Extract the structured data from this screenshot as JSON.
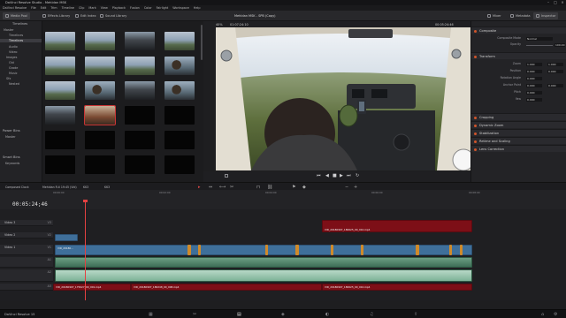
{
  "window": {
    "title": "DaVinci Resolve Studio - Mehldan MSK"
  },
  "menu": [
    "DaVinci Resolve",
    "File",
    "Edit",
    "Trim",
    "Timeline",
    "Clip",
    "Mark",
    "View",
    "Playback",
    "Fusion",
    "Color",
    "Fairlight",
    "Workspace",
    "Help"
  ],
  "toolbar": {
    "media_pool": "Media Pool",
    "effects_library": "Effects Library",
    "edit_index": "Edit Index",
    "sound_library": "Sound Library",
    "project_title": "Mehldan MSK - SPB (Copy)",
    "mixer": "Mixer",
    "metadata": "Metadata",
    "inspector": "Inspector"
  },
  "bins": {
    "header": "Timelines",
    "items": [
      "Master",
      "Timelines",
      "Audio",
      "Video",
      "Images",
      "Old",
      "Grade",
      "Music",
      "Sfx",
      "Nested"
    ],
    "power_bins": "Power Bins",
    "power_items": [
      "Master"
    ],
    "smart_bins": "Smart Bins",
    "smart_items": [
      "Keywords"
    ]
  },
  "viewer": {
    "zoom": "40%",
    "timecode": "01:07:24:10",
    "title": "Mehldan MSK - SPB (Copy)",
    "duration": "00:05:24:46"
  },
  "inspector": {
    "sections": [
      {
        "name": "Composite"
      },
      {
        "name": "Transform"
      },
      {
        "name": "Cropping"
      },
      {
        "name": "Dynamic Zoom"
      },
      {
        "name": "Stabilization"
      },
      {
        "name": "Retime and Scaling"
      },
      {
        "name": "Lens Correction"
      }
    ],
    "composite_mode_label": "Composite Mode",
    "composite_mode": "Normal",
    "opacity_label": "Opacity",
    "opacity": "100.00",
    "zoom_label": "Zoom",
    "zoom_x": "1.000",
    "zoom_y": "1.000",
    "position_label": "Position",
    "pos_x": "0.000",
    "pos_y": "0.000",
    "rotation_label": "Rotation Angle",
    "rotation": "0.000",
    "anchor_label": "Anchor Point",
    "anchor_x": "0.000",
    "anchor_y": "0.000",
    "pitch_label": "Pitch",
    "pitch": "0.000",
    "yaw_label": "Yaw",
    "yaw": "0.000"
  },
  "timeline": {
    "tabs": [
      "Composed Clock",
      "Mehldan R.ti 19:45 (Vid)",
      "KK3",
      "KK3"
    ],
    "timecode": "00:05:24;46",
    "ruler": [
      "00:00:00",
      "00:02:00",
      "00:04:00",
      "00:06:00",
      "00:08:00",
      "00:10:00"
    ],
    "tracks": [
      {
        "name": "Video 3",
        "id": "V3"
      },
      {
        "name": "Video 2",
        "id": "V2"
      },
      {
        "name": "Video 1",
        "id": "V1"
      },
      {
        "name": "",
        "id": "A1"
      },
      {
        "name": "",
        "id": "A2"
      },
      {
        "name": "",
        "id": "A3"
      }
    ],
    "clip_names": {
      "v3_red": "VID_20180907_180625_00_010.mp4",
      "a_red_left": "VID_20180907_175627_00_001.mp4",
      "a_red_mid": "VID_20180907_180248_00_008.mp4",
      "a_red_right": "VID_20180907_180625_00_010.mp4",
      "v1_label": "VID_20180..."
    }
  },
  "pagebar": {
    "brand": "DaVinci Resolve 15",
    "pages": [
      "media",
      "cut",
      "edit",
      "fusion",
      "color",
      "fairlight",
      "deliver"
    ],
    "active": "edit"
  }
}
